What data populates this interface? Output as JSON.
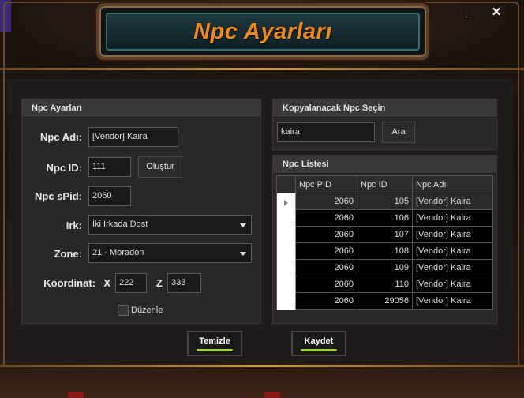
{
  "window": {
    "title": "Npc Ayarları",
    "minimize_glyph": "_",
    "close_glyph": "✕"
  },
  "npc_settings": {
    "header": "Npc Ayarları",
    "name_label": "Npc Adı:",
    "name_value": "[Vendor] Kaira",
    "id_label": "Npc ID:",
    "id_value": "111",
    "create_button": "Oluştur",
    "spid_label": "Npc sPid:",
    "spid_value": "2060",
    "race_label": "Irk:",
    "race_value": "İki Irkada Dost",
    "zone_label": "Zone:",
    "zone_value": "21 - Moradon",
    "coord_label": "Koordinat:",
    "x_label": "X",
    "x_value": "222",
    "z_label": "Z",
    "z_value": "333",
    "edit_checkbox_label": "Düzenle",
    "edit_checked": false
  },
  "copy_npc": {
    "header": "Kopyalanacak Npc Seçin",
    "search_value": "kaira",
    "search_button": "Ara"
  },
  "npc_list": {
    "header": "Npc Listesi",
    "columns": [
      "Npc PID",
      "Npc ID",
      "Npc Adı"
    ],
    "rows": [
      [
        "2060",
        "105",
        "[Vendor] Kaira"
      ],
      [
        "2060",
        "106",
        "[Vendor] Kaira"
      ],
      [
        "2060",
        "107",
        "[Vendor] Kaira"
      ],
      [
        "2060",
        "108",
        "[Vendor] Kaira"
      ],
      [
        "2060",
        "109",
        "[Vendor] Kaira"
      ],
      [
        "2060",
        "110",
        "[Vendor] Kaira"
      ],
      [
        "2060",
        "29056",
        "[Vendor] Kaira"
      ]
    ],
    "selected_row": 0
  },
  "actions": {
    "clear_button": "Temizle",
    "save_button": "Kaydet"
  },
  "colors": {
    "title_orange": "#f08a1c",
    "accent_green": "#9bd33a",
    "frame_brown": "#6b4a2e"
  }
}
